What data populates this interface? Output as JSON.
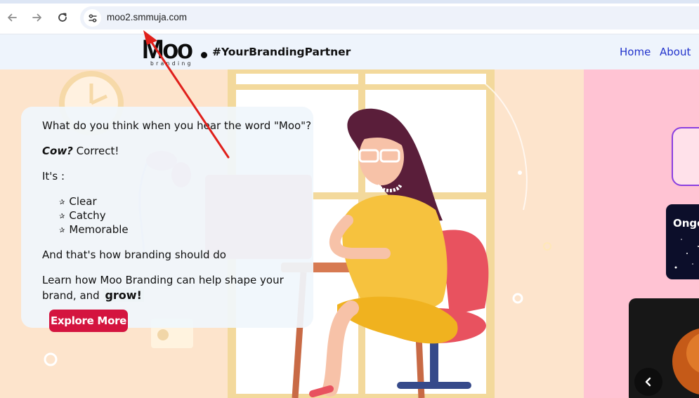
{
  "browser": {
    "url": "moo2.smmuja.com",
    "icons": {
      "back": "back-arrow-icon",
      "forward": "forward-arrow-icon",
      "reload": "reload-icon",
      "site_info": "site-info-icon"
    }
  },
  "header": {
    "logo_text": "Moo",
    "logo_subtext": "branding",
    "tagline": "#YourBrandingPartner",
    "nav": [
      "Home",
      "About"
    ]
  },
  "hero": {
    "question": "What do you think when you hear the word \"Moo\"?",
    "answer_bold": "Cow?",
    "answer_rest": "Correct!",
    "its": "It's :",
    "bullet_glyph": "✰",
    "qualities": [
      "Clear",
      "Catchy",
      "Memorable"
    ],
    "summary": "And that's how branding should do",
    "learn_line1": "Learn how Moo Branding can help shape your",
    "learn_line2": "brand, and",
    "grow": "grow!",
    "cta": "Explore More"
  },
  "side": {
    "ongoing_label": "Ongo",
    "slider_prev_icon": "chevron-left-icon"
  },
  "colors": {
    "hero_bg": "#fde4cc",
    "right_bg": "#ffc3d3",
    "cta": "#d4143f",
    "nav_link": "#2233cc",
    "annotation_arrow": "#e0201b"
  }
}
